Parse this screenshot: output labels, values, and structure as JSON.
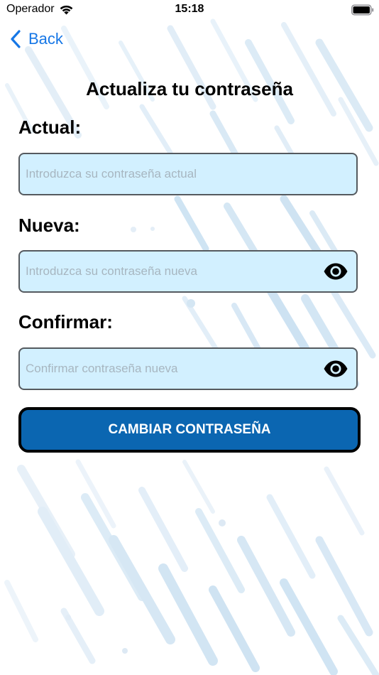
{
  "status_bar": {
    "carrier": "Operador",
    "time": "15:18"
  },
  "nav": {
    "back_label": "Back"
  },
  "page": {
    "title": "Actualiza tu contraseña"
  },
  "fields": {
    "current": {
      "label": "Actual:",
      "value": "",
      "placeholder": "Introduzca su contraseña actual"
    },
    "new": {
      "label": "Nueva:",
      "value": "",
      "placeholder": "Introduzca su contraseña nueva",
      "toggle_icon": "eye-icon"
    },
    "confirm": {
      "label": "Confirmar:",
      "value": "",
      "placeholder": "Confirmar contraseña nueva",
      "toggle_icon": "eye-icon"
    }
  },
  "actions": {
    "submit_label": "CAMBIAR CONTRASEÑA"
  },
  "colors": {
    "accent": "#1677e6",
    "input_background": "#d2f0ff",
    "button_background": "#0b66b1"
  }
}
